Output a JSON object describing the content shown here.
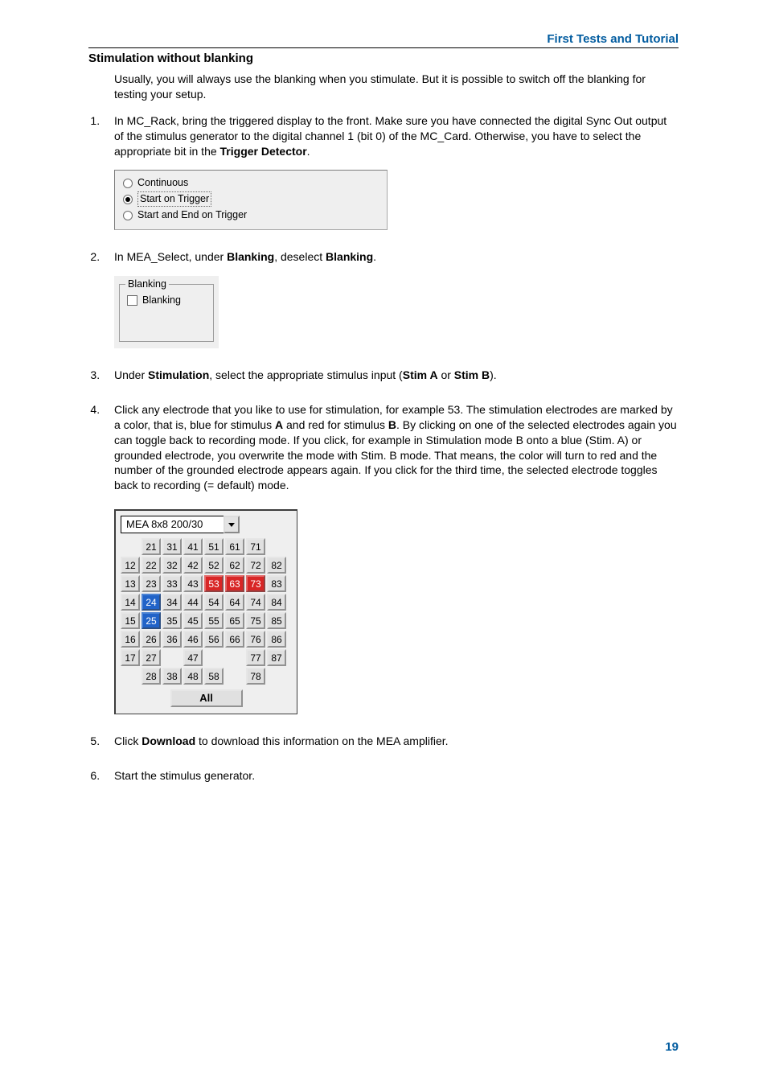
{
  "header": {
    "right": "First Tests and Tutorial"
  },
  "title": "Stimulation without blanking",
  "intro": "Usually, you will always use the blanking when you stimulate. But it is possible to switch off the blanking for testing your setup.",
  "steps": {
    "s1": {
      "pre": "In MC_Rack, bring the triggered display to the front. Make sure you have connected the digital Sync Out output of the stimulus generator to the digital channel 1 (bit 0) of the MC_Card. Otherwise, you have to select the appropriate bit in the ",
      "bold": "Trigger Detector",
      "post": "."
    },
    "s2": {
      "pre": "In MEA_Select, under ",
      "b1": "Blanking",
      "mid": ", deselect ",
      "b2": "Blanking",
      "post": "."
    },
    "s3": {
      "pre": "Under ",
      "b1": "Stimulation",
      "mid": ", select the appropriate stimulus input (",
      "b2": "Stim A",
      "or": " or ",
      "b3": "Stim B",
      "post": ")."
    },
    "s4": {
      "p1": "Click any electrode that you like to use for stimulation, for example 53. The stimulation electrodes are marked by a color, that is, blue for stimulus ",
      "bA": "A",
      "p2": " and red for stimulus ",
      "bB": "B",
      "p3": ". By clicking on one of the selected electrodes again you can toggle back to recording mode. If you click, for example in Stimulation mode B onto a blue (Stim. A) or grounded electrode, you overwrite the mode with Stim. B mode. That means, the color will turn to red and the number of the grounded electrode appears again. If you click for the third time, the selected electrode toggles back to recording (= default) mode."
    },
    "s5": {
      "pre": "Click ",
      "b": "Download",
      "post": " to download this information on the MEA amplifier."
    },
    "s6": "Start the stimulus generator."
  },
  "fig_radio": {
    "options": [
      "Continuous",
      "Start on Trigger",
      "Start and End on Trigger"
    ],
    "selected": 1
  },
  "fig_blanking": {
    "group_title": "Blanking",
    "checkbox_label": "Blanking",
    "checked": false
  },
  "fig_grid": {
    "combo_value": "MEA 8x8 200/30",
    "cells": [
      [
        "",
        "21",
        "31",
        "41",
        "51",
        "61",
        "71",
        ""
      ],
      [
        "12",
        "22",
        "32",
        "42",
        "52",
        "62",
        "72",
        "82"
      ],
      [
        "13",
        "23",
        "33",
        "43",
        "53",
        "63",
        "73",
        "83"
      ],
      [
        "14",
        "24",
        "34",
        "44",
        "54",
        "64",
        "74",
        "84"
      ],
      [
        "15",
        "25",
        "35",
        "45",
        "55",
        "65",
        "75",
        "85"
      ],
      [
        "16",
        "26",
        "36",
        "46",
        "56",
        "66",
        "76",
        "86"
      ],
      [
        "17",
        "27",
        "",
        "47",
        "",
        "",
        "77",
        "87"
      ],
      [
        "",
        "28",
        "38",
        "48",
        "58",
        "",
        "78",
        ""
      ]
    ],
    "blue": [
      "24",
      "25"
    ],
    "red": [
      "53",
      "63",
      "73"
    ],
    "all_label": "All"
  },
  "pagenum": "19"
}
